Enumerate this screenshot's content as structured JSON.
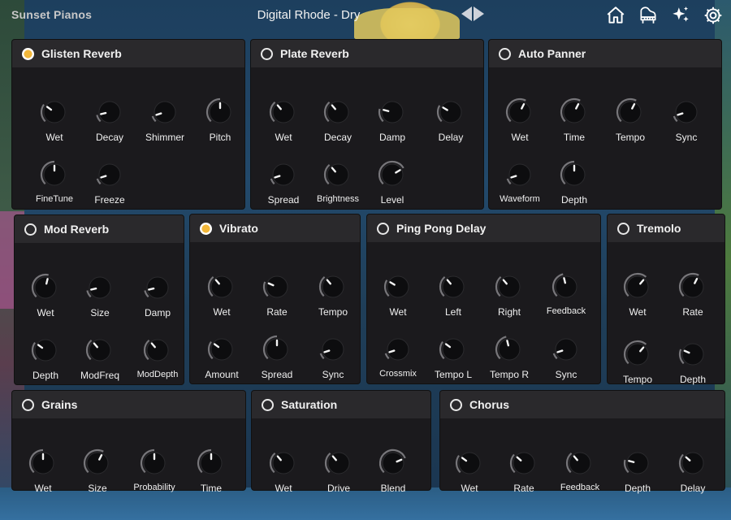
{
  "app": {
    "brand": "Sunset Pianos",
    "preset": "Digital Rhode - Dry",
    "nav_icons": [
      "home-icon",
      "piano-icon",
      "sparkle-icon",
      "gear-icon"
    ]
  },
  "panels": [
    {
      "id": "glisten-reverb",
      "title": "Glisten Reverb",
      "active": true,
      "knobs": [
        {
          "label": "Wet",
          "value": 0.3
        },
        {
          "label": "Decay",
          "value": 0.12
        },
        {
          "label": "Shimmer",
          "value": 0.1
        },
        {
          "label": "Pitch",
          "value": 0.5
        },
        {
          "label": "FineTune",
          "value": 0.5
        },
        {
          "label": "Freeze",
          "value": 0.1
        }
      ]
    },
    {
      "id": "plate-reverb",
      "title": "Plate Reverb",
      "active": false,
      "knobs": [
        {
          "label": "Wet",
          "value": 0.35
        },
        {
          "label": "Decay",
          "value": 0.35
        },
        {
          "label": "Damp",
          "value": 0.22
        },
        {
          "label": "Delay",
          "value": 0.28
        },
        {
          "label": "Spread",
          "value": 0.1
        },
        {
          "label": "Brightness",
          "value": 0.35
        },
        {
          "label": "Level",
          "value": 0.72
        }
      ]
    },
    {
      "id": "auto-panner",
      "title": "Auto Panner",
      "active": false,
      "knobs": [
        {
          "label": "Wet",
          "value": 0.6
        },
        {
          "label": "Time",
          "value": 0.6
        },
        {
          "label": "Tempo",
          "value": 0.6
        },
        {
          "label": "Sync",
          "value": 0.1
        },
        {
          "label": "Waveform",
          "value": 0.1
        },
        {
          "label": "Depth",
          "value": 0.5
        }
      ]
    },
    {
      "id": "mod-reverb",
      "title": "Mod Reverb",
      "active": false,
      "knobs": [
        {
          "label": "Wet",
          "value": 0.55
        },
        {
          "label": "Size",
          "value": 0.12
        },
        {
          "label": "Damp",
          "value": 0.12
        },
        {
          "label": "Depth",
          "value": 0.3
        },
        {
          "label": "ModFreq",
          "value": 0.35
        },
        {
          "label": "ModDepth",
          "value": 0.35
        }
      ]
    },
    {
      "id": "vibrato",
      "title": "Vibrato",
      "active": true,
      "knobs": [
        {
          "label": "Wet",
          "value": 0.35
        },
        {
          "label": "Rate",
          "value": 0.25
        },
        {
          "label": "Tempo",
          "value": 0.35
        },
        {
          "label": "Amount",
          "value": 0.3
        },
        {
          "label": "Spread",
          "value": 0.5
        },
        {
          "label": "Sync",
          "value": 0.1
        }
      ]
    },
    {
      "id": "ping-pong-delay",
      "title": "Ping Pong Delay",
      "active": false,
      "knobs": [
        {
          "label": "Wet",
          "value": 0.28
        },
        {
          "label": "Left",
          "value": 0.35
        },
        {
          "label": "Right",
          "value": 0.35
        },
        {
          "label": "Feedback",
          "value": 0.45
        },
        {
          "label": "Crossmix",
          "value": 0.1
        },
        {
          "label": "Tempo L",
          "value": 0.3
        },
        {
          "label": "Tempo R",
          "value": 0.45
        },
        {
          "label": "Sync",
          "value": 0.1
        }
      ]
    },
    {
      "id": "tremolo",
      "title": "Tremolo",
      "active": false,
      "knobs": [
        {
          "label": "Wet",
          "value": 0.65
        },
        {
          "label": "Rate",
          "value": 0.6
        },
        {
          "label": "Tempo",
          "value": 0.65
        },
        {
          "label": "Depth",
          "value": 0.25
        }
      ]
    },
    {
      "id": "grains",
      "title": "Grains",
      "active": false,
      "knobs": [
        {
          "label": "Wet",
          "value": 0.5
        },
        {
          "label": "Size",
          "value": 0.6
        },
        {
          "label": "Probability",
          "value": 0.5
        },
        {
          "label": "Time",
          "value": 0.5
        }
      ]
    },
    {
      "id": "saturation",
      "title": "Saturation",
      "active": false,
      "knobs": [
        {
          "label": "Wet",
          "value": 0.35
        },
        {
          "label": "Drive",
          "value": 0.35
        },
        {
          "label": "Blend",
          "value": 0.75
        }
      ]
    },
    {
      "id": "chorus",
      "title": "Chorus",
      "active": false,
      "knobs": [
        {
          "label": "Wet",
          "value": 0.3
        },
        {
          "label": "Rate",
          "value": 0.32
        },
        {
          "label": "Feedback",
          "value": 0.35
        },
        {
          "label": "Depth",
          "value": 0.22
        },
        {
          "label": "Delay",
          "value": 0.32
        }
      ]
    }
  ],
  "colors": {
    "accent": "#f2b73a",
    "panel": "#1b1a1d",
    "header": "#2a292c"
  }
}
